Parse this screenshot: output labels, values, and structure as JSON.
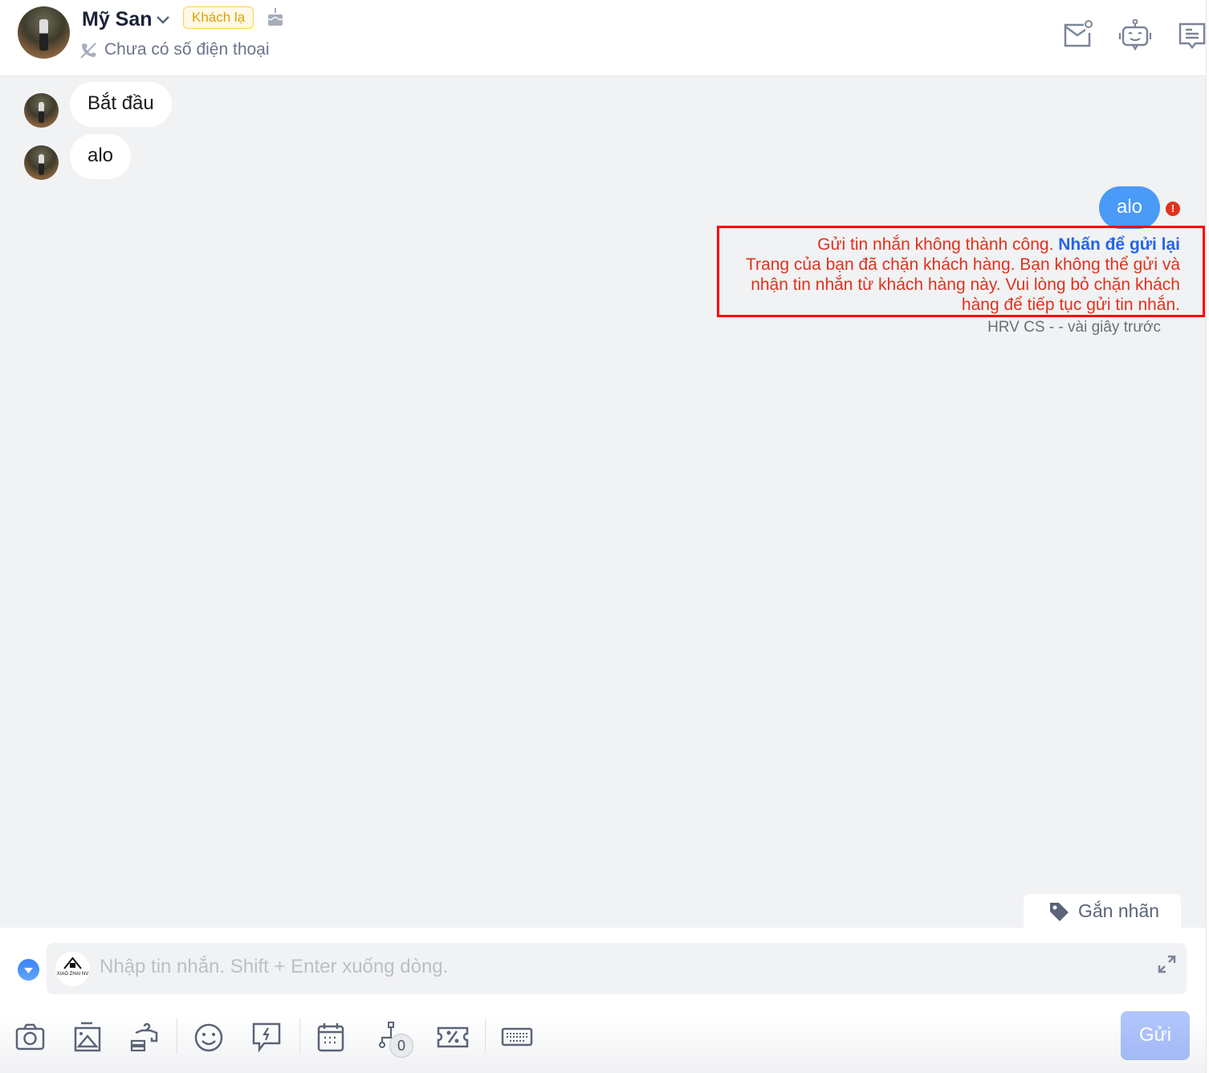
{
  "header": {
    "contact_name": "Mỹ San",
    "badge": "Khách lạ",
    "phone": "Chưa có số điện thoại"
  },
  "messages": [
    {
      "direction": "in",
      "text": "Bắt đầu"
    },
    {
      "direction": "in",
      "text": "alo"
    },
    {
      "direction": "out",
      "text": "alo",
      "status": "failed"
    }
  ],
  "error": {
    "title": "Gửi tin nhắn không thành công.",
    "resend": "Nhấn để gửi lại",
    "detail": "Trang của bạn đã chặn khách hàng. Bạn không thể gửi và nhận tin nhắn từ khách hàng này. Vui lòng bỏ chặn khách hàng để tiếp tục gửi tin nhắn."
  },
  "meta": "HRV CS - - vài giây trước",
  "tag_button": "Gắn nhãn",
  "composer": {
    "placeholder": "Nhập tin nhắn. Shift + Enter xuống dòng.",
    "page_logo": "XIAO ZHAI NV",
    "flow_count": "0",
    "send": "Gửi"
  },
  "colors": {
    "accent": "#4a9af7",
    "error": "#e0321c",
    "link": "#2563eb",
    "send": "#a9bff9"
  }
}
